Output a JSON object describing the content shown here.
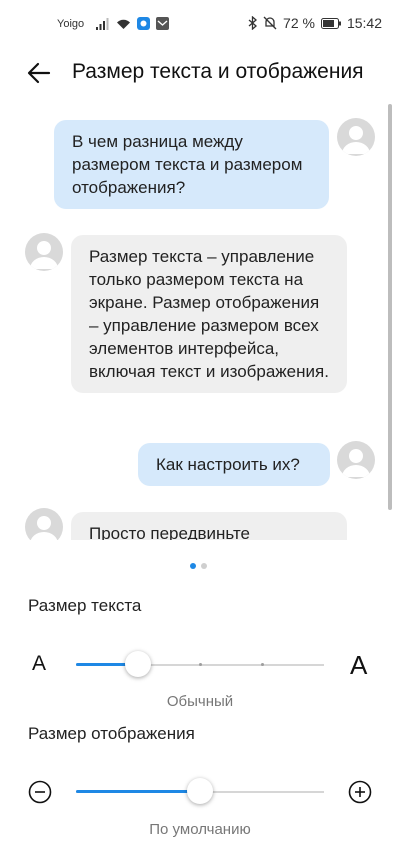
{
  "status_bar": {
    "carrier": "Yoigo",
    "battery": "72 %",
    "time": "15:42"
  },
  "header": {
    "title": "Размер текста и отображения"
  },
  "chat": {
    "messages": [
      {
        "from": "user",
        "text": "В чем разница между размером текста и размером отображения?"
      },
      {
        "from": "bot",
        "text": "Размер текста – управление только размером текста на экране. Размер отображения – управление размером всех элементов интерфейса, включая текст и изображения."
      },
      {
        "from": "user",
        "text": "Как настроить их?"
      },
      {
        "from": "bot",
        "text": "Просто передвиньте"
      }
    ]
  },
  "pager": {
    "pages": 2,
    "current": 1
  },
  "text_size": {
    "label": "Размер текста",
    "small_icon": "A",
    "large_icon": "A",
    "value_label": "Обычный",
    "steps": 4,
    "selected_step": 1,
    "accent": "#1e88e5"
  },
  "display_size": {
    "label": "Размер отображения",
    "value_label": "По умолчанию",
    "minus_icon": "minus-circle-icon",
    "plus_icon": "plus-circle-icon",
    "level": 0.5
  }
}
